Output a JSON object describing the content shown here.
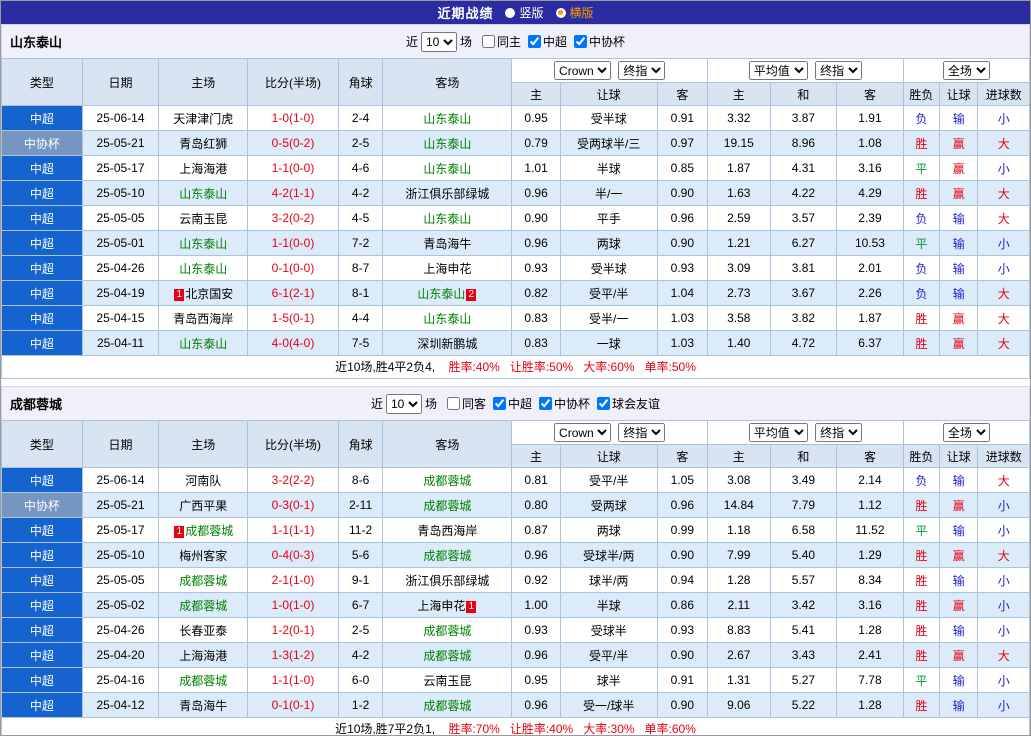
{
  "top_bar": {
    "title": "近期战绩",
    "radios": [
      {
        "label": "竖版",
        "selected": false
      },
      {
        "label": "横版",
        "selected": true
      }
    ]
  },
  "table_header": {
    "left_cols": [
      "类型",
      "日期",
      "主场",
      "比分(半场)",
      "角球",
      "客场"
    ],
    "sub_cols": [
      "主",
      "让球",
      "客",
      "主",
      "和",
      "客",
      "胜负",
      "让球",
      "进球数"
    ],
    "dropdowns": {
      "bookmaker": "Crown",
      "final1": "终指",
      "average": "平均值",
      "final2": "终指",
      "fullmatch": "全场"
    }
  },
  "result_colors": {
    "胜": "#e60012",
    "赢": "#e60012",
    "大": "#e60012",
    "平": "#009933",
    "负": "#2222cc",
    "输": "#2222cc",
    "小": "#2222cc"
  },
  "colors": {
    "topbar_bg": "#2b2ba2",
    "selected_radio": "#ff9900",
    "focus_team": "#008000",
    "score": "#e60012",
    "csl_badge_bg": "#1463cf",
    "cup_badge_bg": "#7695c1",
    "row_alt_bg": "#dcebfa",
    "header_bg": "#d8e4f1"
  },
  "sections": [
    {
      "team": "山东泰山",
      "filter": {
        "prefix": "近",
        "count": "10",
        "suffix": "场",
        "checkboxes": [
          {
            "label": "同主",
            "checked": false
          },
          {
            "label": "中超",
            "checked": true
          },
          {
            "label": "中协杯",
            "checked": true
          }
        ]
      },
      "rows": [
        {
          "league": "中超",
          "cup": false,
          "date": "25-06-14",
          "home": {
            "name": "天津津门虎",
            "focus": false,
            "red": ""
          },
          "score": "1-0(1-0)",
          "corner": "2-4",
          "away": {
            "name": "山东泰山",
            "focus": true,
            "red": ""
          },
          "w1": "0.95",
          "hcp": "受半球",
          "w2": "0.91",
          "a1": "3.32",
          "a2": "3.87",
          "a3": "1.91",
          "r1": "负",
          "r2": "输",
          "r3": "小"
        },
        {
          "league": "中协杯",
          "cup": true,
          "date": "25-05-21",
          "home": {
            "name": "青岛红狮",
            "focus": false,
            "red": ""
          },
          "score": "0-5(0-2)",
          "corner": "2-5",
          "away": {
            "name": "山东泰山",
            "focus": true,
            "red": ""
          },
          "w1": "0.79",
          "hcp": "受两球半/三",
          "w2": "0.97",
          "a1": "19.15",
          "a2": "8.96",
          "a3": "1.08",
          "r1": "胜",
          "r2": "赢",
          "r3": "大"
        },
        {
          "league": "中超",
          "cup": false,
          "date": "25-05-17",
          "home": {
            "name": "上海海港",
            "focus": false,
            "red": ""
          },
          "score": "1-1(0-0)",
          "corner": "4-6",
          "away": {
            "name": "山东泰山",
            "focus": true,
            "red": ""
          },
          "w1": "1.01",
          "hcp": "半球",
          "w2": "0.85",
          "a1": "1.87",
          "a2": "4.31",
          "a3": "3.16",
          "r1": "平",
          "r2": "赢",
          "r3": "小"
        },
        {
          "league": "中超",
          "cup": false,
          "date": "25-05-10",
          "home": {
            "name": "山东泰山",
            "focus": true,
            "red": ""
          },
          "score": "4-2(1-1)",
          "corner": "4-2",
          "away": {
            "name": "浙江俱乐部绿城",
            "focus": false,
            "red": ""
          },
          "w1": "0.96",
          "hcp": "半/一",
          "w2": "0.90",
          "a1": "1.63",
          "a2": "4.22",
          "a3": "4.29",
          "r1": "胜",
          "r2": "赢",
          "r3": "大"
        },
        {
          "league": "中超",
          "cup": false,
          "date": "25-05-05",
          "home": {
            "name": "云南玉昆",
            "focus": false,
            "red": ""
          },
          "score": "3-2(0-2)",
          "corner": "4-5",
          "away": {
            "name": "山东泰山",
            "focus": true,
            "red": ""
          },
          "w1": "0.90",
          "hcp": "平手",
          "w2": "0.96",
          "a1": "2.59",
          "a2": "3.57",
          "a3": "2.39",
          "r1": "负",
          "r2": "输",
          "r3": "大"
        },
        {
          "league": "中超",
          "cup": false,
          "date": "25-05-01",
          "home": {
            "name": "山东泰山",
            "focus": true,
            "red": ""
          },
          "score": "1-1(0-0)",
          "corner": "7-2",
          "away": {
            "name": "青岛海牛",
            "focus": false,
            "red": ""
          },
          "w1": "0.96",
          "hcp": "两球",
          "w2": "0.90",
          "a1": "1.21",
          "a2": "6.27",
          "a3": "10.53",
          "r1": "平",
          "r2": "输",
          "r3": "小"
        },
        {
          "league": "中超",
          "cup": false,
          "date": "25-04-26",
          "home": {
            "name": "山东泰山",
            "focus": true,
            "red": ""
          },
          "score": "0-1(0-0)",
          "corner": "8-7",
          "away": {
            "name": "上海申花",
            "focus": false,
            "red": ""
          },
          "w1": "0.93",
          "hcp": "受半球",
          "w2": "0.93",
          "a1": "3.09",
          "a2": "3.81",
          "a3": "2.01",
          "r1": "负",
          "r2": "输",
          "r3": "小"
        },
        {
          "league": "中超",
          "cup": false,
          "date": "25-04-19",
          "home": {
            "name": "北京国安",
            "focus": false,
            "red": "1"
          },
          "score": "6-1(2-1)",
          "corner": "8-1",
          "away": {
            "name": "山东泰山",
            "focus": true,
            "red": "2"
          },
          "w1": "0.82",
          "hcp": "受平/半",
          "w2": "1.04",
          "a1": "2.73",
          "a2": "3.67",
          "a3": "2.26",
          "r1": "负",
          "r2": "输",
          "r3": "大"
        },
        {
          "league": "中超",
          "cup": false,
          "date": "25-04-15",
          "home": {
            "name": "青岛西海岸",
            "focus": false,
            "red": ""
          },
          "score": "1-5(0-1)",
          "corner": "4-4",
          "away": {
            "name": "山东泰山",
            "focus": true,
            "red": ""
          },
          "w1": "0.83",
          "hcp": "受半/一",
          "w2": "1.03",
          "a1": "3.58",
          "a2": "3.82",
          "a3": "1.87",
          "r1": "胜",
          "r2": "赢",
          "r3": "大"
        },
        {
          "league": "中超",
          "cup": false,
          "date": "25-04-11",
          "home": {
            "name": "山东泰山",
            "focus": true,
            "red": ""
          },
          "score": "4-0(4-0)",
          "corner": "7-5",
          "away": {
            "name": "深圳新鹏城",
            "focus": false,
            "red": ""
          },
          "w1": "0.83",
          "hcp": "一球",
          "w2": "1.03",
          "a1": "1.40",
          "a2": "4.72",
          "a3": "6.37",
          "r1": "胜",
          "r2": "赢",
          "r3": "大"
        }
      ],
      "summary": {
        "prefix": "近10场,胜4平2负4,",
        "stats": [
          "胜率:40%",
          "让胜率:50%",
          "大率:60%",
          "单率:50%"
        ]
      }
    },
    {
      "team": "成都蓉城",
      "filter": {
        "prefix": "近",
        "count": "10",
        "suffix": "场",
        "checkboxes": [
          {
            "label": "同客",
            "checked": false
          },
          {
            "label": "中超",
            "checked": true
          },
          {
            "label": "中协杯",
            "checked": true
          },
          {
            "label": "球会友谊",
            "checked": true
          }
        ]
      },
      "rows": [
        {
          "league": "中超",
          "cup": false,
          "date": "25-06-14",
          "home": {
            "name": "河南队",
            "focus": false,
            "red": ""
          },
          "score": "3-2(2-2)",
          "corner": "8-6",
          "away": {
            "name": "成都蓉城",
            "focus": true,
            "red": ""
          },
          "w1": "0.81",
          "hcp": "受平/半",
          "w2": "1.05",
          "a1": "3.08",
          "a2": "3.49",
          "a3": "2.14",
          "r1": "负",
          "r2": "输",
          "r3": "大"
        },
        {
          "league": "中协杯",
          "cup": true,
          "date": "25-05-21",
          "home": {
            "name": "广西平果",
            "focus": false,
            "red": ""
          },
          "score": "0-3(0-1)",
          "corner": "2-11",
          "away": {
            "name": "成都蓉城",
            "focus": true,
            "red": ""
          },
          "w1": "0.80",
          "hcp": "受两球",
          "w2": "0.96",
          "a1": "14.84",
          "a2": "7.79",
          "a3": "1.12",
          "r1": "胜",
          "r2": "赢",
          "r3": "小"
        },
        {
          "league": "中超",
          "cup": false,
          "date": "25-05-17",
          "home": {
            "name": "成都蓉城",
            "focus": true,
            "red": "1"
          },
          "score": "1-1(1-1)",
          "corner": "11-2",
          "away": {
            "name": "青岛西海岸",
            "focus": false,
            "red": ""
          },
          "w1": "0.87",
          "hcp": "两球",
          "w2": "0.99",
          "a1": "1.18",
          "a2": "6.58",
          "a3": "11.52",
          "r1": "平",
          "r2": "输",
          "r3": "小"
        },
        {
          "league": "中超",
          "cup": false,
          "date": "25-05-10",
          "home": {
            "name": "梅州客家",
            "focus": false,
            "red": ""
          },
          "score": "0-4(0-3)",
          "corner": "5-6",
          "away": {
            "name": "成都蓉城",
            "focus": true,
            "red": ""
          },
          "w1": "0.96",
          "hcp": "受球半/两",
          "w2": "0.90",
          "a1": "7.99",
          "a2": "5.40",
          "a3": "1.29",
          "r1": "胜",
          "r2": "赢",
          "r3": "大"
        },
        {
          "league": "中超",
          "cup": false,
          "date": "25-05-05",
          "home": {
            "name": "成都蓉城",
            "focus": true,
            "red": ""
          },
          "score": "2-1(1-0)",
          "corner": "9-1",
          "away": {
            "name": "浙江俱乐部绿城",
            "focus": false,
            "red": ""
          },
          "w1": "0.92",
          "hcp": "球半/两",
          "w2": "0.94",
          "a1": "1.28",
          "a2": "5.57",
          "a3": "8.34",
          "r1": "胜",
          "r2": "输",
          "r3": "小"
        },
        {
          "league": "中超",
          "cup": false,
          "date": "25-05-02",
          "home": {
            "name": "成都蓉城",
            "focus": true,
            "red": ""
          },
          "score": "1-0(1-0)",
          "corner": "6-7",
          "away": {
            "name": "上海申花",
            "focus": false,
            "red": "1"
          },
          "w1": "1.00",
          "hcp": "半球",
          "w2": "0.86",
          "a1": "2.11",
          "a2": "3.42",
          "a3": "3.16",
          "r1": "胜",
          "r2": "赢",
          "r3": "小"
        },
        {
          "league": "中超",
          "cup": false,
          "date": "25-04-26",
          "home": {
            "name": "长春亚泰",
            "focus": false,
            "red": ""
          },
          "score": "1-2(0-1)",
          "corner": "2-5",
          "away": {
            "name": "成都蓉城",
            "focus": true,
            "red": ""
          },
          "w1": "0.93",
          "hcp": "受球半",
          "w2": "0.93",
          "a1": "8.83",
          "a2": "5.41",
          "a3": "1.28",
          "r1": "胜",
          "r2": "输",
          "r3": "小"
        },
        {
          "league": "中超",
          "cup": false,
          "date": "25-04-20",
          "home": {
            "name": "上海海港",
            "focus": false,
            "red": ""
          },
          "score": "1-3(1-2)",
          "corner": "4-2",
          "away": {
            "name": "成都蓉城",
            "focus": true,
            "red": ""
          },
          "w1": "0.96",
          "hcp": "受平/半",
          "w2": "0.90",
          "a1": "2.67",
          "a2": "3.43",
          "a3": "2.41",
          "r1": "胜",
          "r2": "赢",
          "r3": "大"
        },
        {
          "league": "中超",
          "cup": false,
          "date": "25-04-16",
          "home": {
            "name": "成都蓉城",
            "focus": true,
            "red": ""
          },
          "score": "1-1(1-0)",
          "corner": "6-0",
          "away": {
            "name": "云南玉昆",
            "focus": false,
            "red": ""
          },
          "w1": "0.95",
          "hcp": "球半",
          "w2": "0.91",
          "a1": "1.31",
          "a2": "5.27",
          "a3": "7.78",
          "r1": "平",
          "r2": "输",
          "r3": "小"
        },
        {
          "league": "中超",
          "cup": false,
          "date": "25-04-12",
          "home": {
            "name": "青岛海牛",
            "focus": false,
            "red": ""
          },
          "score": "0-1(0-1)",
          "corner": "1-2",
          "away": {
            "name": "成都蓉城",
            "focus": true,
            "red": ""
          },
          "w1": "0.96",
          "hcp": "受一/球半",
          "w2": "0.90",
          "a1": "9.06",
          "a2": "5.22",
          "a3": "1.28",
          "r1": "胜",
          "r2": "输",
          "r3": "小"
        }
      ],
      "summary": {
        "prefix": "近10场,胜7平2负1,",
        "stats": [
          "胜率:70%",
          "让胜率:40%",
          "大率:30%",
          "单率:60%"
        ]
      }
    }
  ]
}
